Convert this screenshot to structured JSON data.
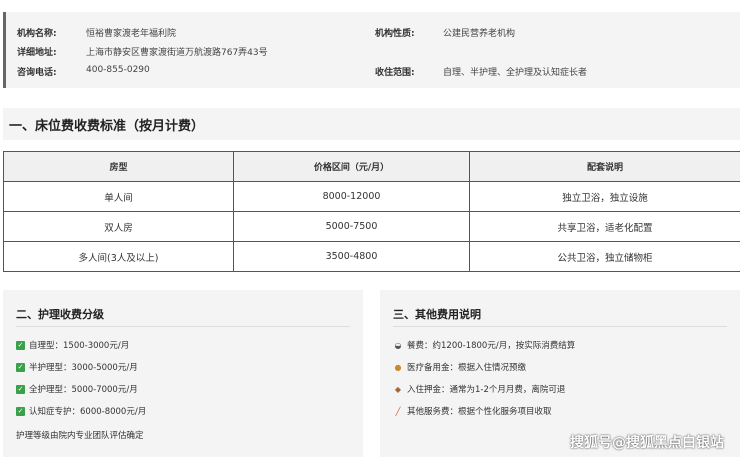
{
  "info": {
    "name_label": "机构名称:",
    "name_value": "恒裕曹家渡老年福利院",
    "nature_label": "机构性质:",
    "nature_value": "公建民营养老机构",
    "address_label": "详细地址:",
    "address_value": "上海市静安区曹家渡街道万航渡路767弄43号",
    "phone_label": "咨询电话:",
    "phone_value": "400-855-0290",
    "scope_label": "收住范围:",
    "scope_value": "自理、半护理、全护理及认知症长者"
  },
  "section1": {
    "title": "一、床位费收费标准（按月计费）"
  },
  "price_table": {
    "headers": [
      "房型",
      "价格区间（元/月）",
      "配套说明"
    ],
    "rows": [
      [
        "单人间",
        "8000-12000",
        "独立卫浴，独立设施"
      ],
      [
        "双人房",
        "5000-7500",
        "共享卫浴，适老化配置"
      ],
      [
        "多人间(3人及以上)",
        "3500-4800",
        "公共卫浴，独立储物柜"
      ]
    ]
  },
  "care": {
    "title": "二、护理收费分级",
    "items": [
      "自理型：1500-3000元/月",
      "半护理型：3000-5000元/月",
      "全护理型：5000-7000元/月",
      "认知症专护：6000-8000元/月"
    ],
    "note": "护理等级由院内专业团队评估确定"
  },
  "other": {
    "title": "三、其他费用说明",
    "items": [
      {
        "icon": "bowl-icon",
        "glyph": "🍲",
        "text": "餐费：约1200-1800元/月，按实际消费结算"
      },
      {
        "icon": "medical-bag-icon",
        "glyph": "💰",
        "text": "医疗备用金：根据入住情况预缴"
      },
      {
        "icon": "deposit-box-icon",
        "glyph": "📦",
        "text": "入住押金：通常为1-2个月月费，离院可退"
      },
      {
        "icon": "pen-icon",
        "glyph": "✏",
        "text": "其他服务费：根据个性化服务项目收取"
      }
    ]
  },
  "watermark": "搜狐号@搜狐黑点白银站"
}
